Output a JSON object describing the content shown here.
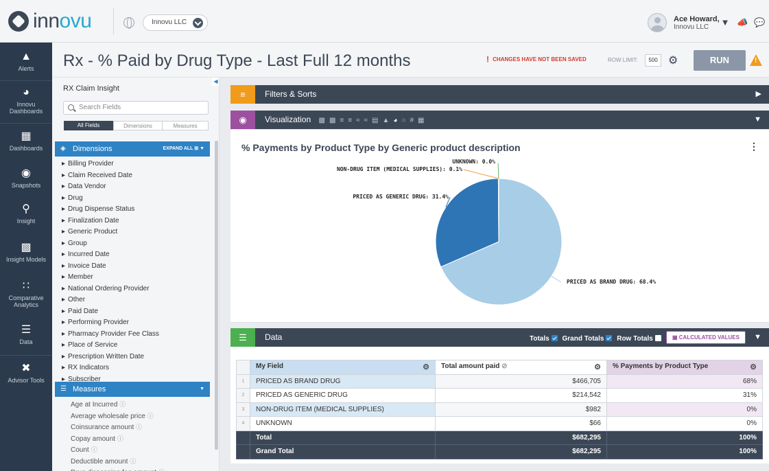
{
  "brand": {
    "logo_text_a": "inn",
    "logo_text_b": "ovu"
  },
  "header": {
    "org_selector": "Innovu LLC",
    "user_name": "Ace Howard,",
    "user_org": "Innovu LLC"
  },
  "nav": [
    {
      "label": "Alerts",
      "icon": "alert-icon"
    },
    {
      "label": "Innovu Dashboards",
      "icon": "speedometer-icon"
    },
    {
      "label": "Dashboards",
      "icon": "grid-icon"
    },
    {
      "label": "Snapshots",
      "icon": "camera-icon"
    },
    {
      "label": "Insight",
      "icon": "lightbulb-icon"
    },
    {
      "label": "Insight Models",
      "icon": "bar-chart-icon"
    },
    {
      "label": "Comparative Analytics",
      "icon": "scatter-icon"
    },
    {
      "label": "Data",
      "icon": "database-icon"
    },
    {
      "label": "Advisor Tools",
      "icon": "tools-icon"
    }
  ],
  "page": {
    "title": "Rx - % Paid by Drug Type - Last Full 12 months",
    "unsaved_notice": "CHANGES HAVE NOT BEEN SAVED",
    "row_limit_label": "ROW LIMIT:",
    "row_limit_value": "500",
    "run_label": "RUN"
  },
  "field_panel": {
    "title": "RX Claim Insight",
    "search_placeholder": "Search Fields",
    "tabs": [
      "All Fields",
      "Dimensions",
      "Measures"
    ],
    "dimensions_label": "Dimensions",
    "expand_all_label": "EXPAND ALL",
    "dimensions": [
      "Billing Provider",
      "Claim Received Date",
      "Data Vendor",
      "Drug",
      "Drug Dispense Status",
      "Finalization Date",
      "Generic Product",
      "Group",
      "Incurred Date",
      "Invoice Date",
      "Member",
      "National Ordering Provider",
      "Other",
      "Paid Date",
      "Performing Provider",
      "Pharmacy Provider Fee Class",
      "Place of Service",
      "Prescription Written Date",
      "RX Indicators",
      "Subscriber"
    ],
    "measures_label": "Measures",
    "measures": [
      "Age at Incurred",
      "Average wholesale price",
      "Coinsurance amount",
      "Copay amount",
      "Count",
      "Deductible amount",
      "Drug dispensing fee amount"
    ]
  },
  "strips": {
    "filters_label": "Filters & Sorts",
    "visualization_label": "Visualization",
    "data_label": "Data",
    "totals_label": "Totals",
    "grand_totals_label": "Grand Totals",
    "row_totals_label": "Row Totals",
    "calculated_values_label": "CALCULATED VALUES"
  },
  "chart_data": {
    "type": "pie",
    "title": "% Payments by Product Type by Generic product description",
    "slices": [
      {
        "label": "PRICED AS BRAND DRUG",
        "value": 68.4,
        "color": "#a8cde6"
      },
      {
        "label": "PRICED AS GENERIC DRUG",
        "value": 31.4,
        "color": "#2e75b6"
      },
      {
        "label": "NON-DRUG ITEM (MEDICAL SUPPLIES)",
        "value": 0.1,
        "color": "#f0a040"
      },
      {
        "label": "UNKNOWN",
        "value": 0.0,
        "color": "#5cb85c"
      }
    ],
    "label_texts": [
      "PRICED AS BRAND DRUG: 68.4%",
      "PRICED AS GENERIC DRUG: 31.4%",
      "NON-DRUG ITEM (MEDICAL SUPPLIES): 0.1%",
      "UNKNOWN: 0.0%"
    ]
  },
  "table": {
    "headers": [
      "My Field",
      "Total amount paid",
      "% Payments by Product Type"
    ],
    "rows": [
      {
        "n": "1",
        "field": "PRICED AS BRAND DRUG",
        "paid": "$466,705",
        "pct": "68%"
      },
      {
        "n": "2",
        "field": "PRICED AS GENERIC DRUG",
        "paid": "$214,542",
        "pct": "31%"
      },
      {
        "n": "3",
        "field": "NON-DRUG ITEM (MEDICAL SUPPLIES)",
        "paid": "$982",
        "pct": "0%"
      },
      {
        "n": "4",
        "field": "UNKNOWN",
        "paid": "$66",
        "pct": "0%"
      }
    ],
    "total": {
      "label": "Total",
      "paid": "$682,295",
      "pct": "100%"
    },
    "grand_total": {
      "label": "Grand Total",
      "paid": "$682,295",
      "pct": "100%"
    }
  }
}
